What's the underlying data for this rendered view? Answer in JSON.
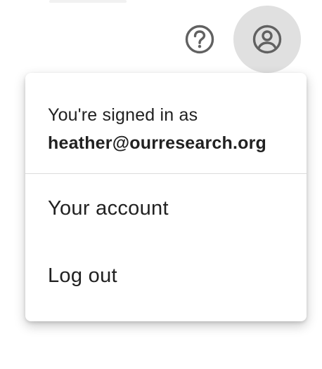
{
  "header": {
    "help_icon": "help-circle-outline-icon",
    "account_icon": "account-circle-outline-icon",
    "icon_color": "#616161",
    "account_button_bg": "#e0e0e0"
  },
  "account_menu": {
    "signed_in_label": "You're signed in as",
    "email": "heather@ourresearch.org",
    "items": [
      {
        "label": "Your account"
      },
      {
        "label": "Log out"
      }
    ]
  }
}
